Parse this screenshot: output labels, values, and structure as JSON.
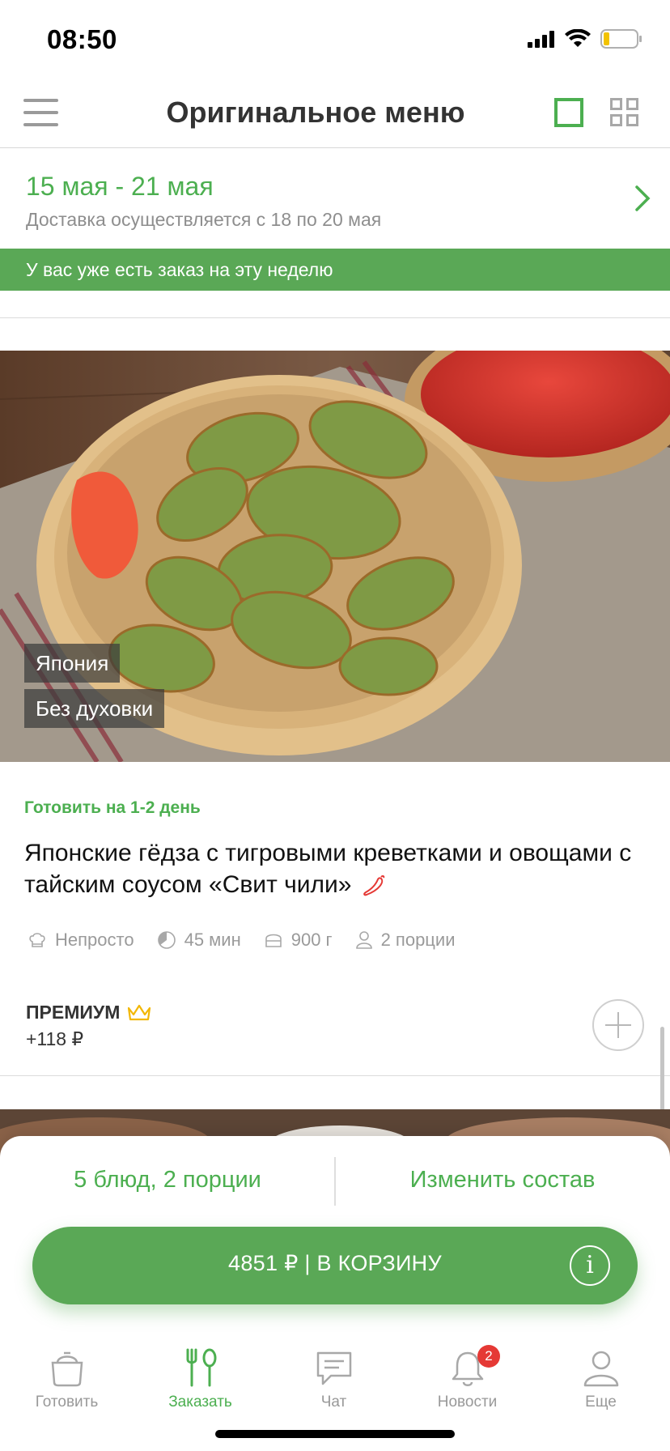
{
  "status_bar": {
    "time": "08:50"
  },
  "header": {
    "title": "Оригинальное меню",
    "menu_icon": "hamburger-icon",
    "view_single_icon": "single-view-icon",
    "view_grid_icon": "grid-view-icon"
  },
  "week": {
    "range": "15 мая - 21 мая",
    "delivery": "Доставка осуществляется с 18 по 20 мая"
  },
  "banner": {
    "text": "У вас уже есть заказ на эту неделю"
  },
  "dish": {
    "tags": [
      "Япония",
      "Без духовки"
    ],
    "cook_day": "Готовить на 1-2 день",
    "title": "Японские гёдза с тигровыми креветками и овощами с тайским соусом «Свит чили»",
    "meta": {
      "difficulty": "Непросто",
      "time": "45 мин",
      "weight": "900 г",
      "portions": "2 порции"
    },
    "premium_label": "ПРЕМИУМ",
    "premium_price": "+118 ₽"
  },
  "sheet": {
    "summary": "5 блюд, 2 порции",
    "change": "Изменить состав",
    "cart": "4851 ₽ | В КОРЗИНУ"
  },
  "tabs": [
    {
      "label": "Готовить",
      "icon": "pot-icon"
    },
    {
      "label": "Заказать",
      "icon": "fork-spoon-icon"
    },
    {
      "label": "Чат",
      "icon": "chat-icon"
    },
    {
      "label": "Новости",
      "icon": "bell-icon",
      "badge": "2"
    },
    {
      "label": "Еще",
      "icon": "profile-icon"
    }
  ],
  "colors": {
    "accent": "#4caf50",
    "banner": "#5aa856",
    "badge": "#e53935"
  }
}
